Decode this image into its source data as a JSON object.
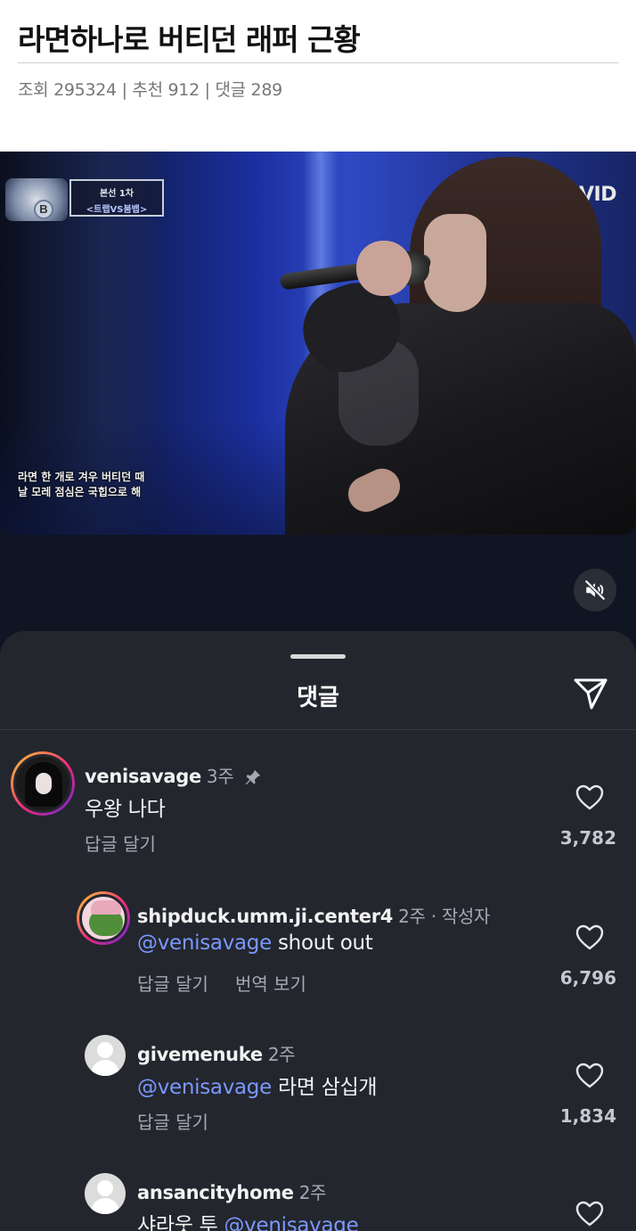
{
  "post": {
    "title": "라면하나로 버티던 래퍼 근황",
    "meta": "조회 295324 | 추천 912 | 댓글 289"
  },
  "video": {
    "round_line1": "본선 1차",
    "round_line2": "<트랩VS붐뱁>",
    "channel_logo": "VIVID",
    "subtitle_line1": "라면 한 개로 겨우 버티던 때",
    "subtitle_line2": "날 모레 점심은 국힙으로 해",
    "mute_icon": "speaker-muted-icon"
  },
  "comments_sheet": {
    "title": "댓글",
    "send_icon": "paper-plane-icon",
    "reply_label": "답글 달기",
    "translate_label": "번역 보기",
    "items": [
      {
        "username": "venisavage",
        "time": "3주",
        "pinned": true,
        "text": "우왕 나다",
        "likes": "3,782"
      },
      {
        "username": "shipduck.umm.ji.center4",
        "time": "2주 · 작성자",
        "mention": "@venisavage",
        "text": " shout out",
        "likes": "6,796"
      },
      {
        "username": "givemenuke",
        "time": "2주",
        "mention": "@venisavage",
        "text": " 라면 삼십개",
        "likes": "1,834"
      },
      {
        "username": "ansancityhome",
        "time": "2주",
        "prefix": "샤라웃 투 ",
        "mention": "@venisavage"
      }
    ]
  },
  "colors": {
    "sheet_bg": "#23262d",
    "mention": "#7b98ff",
    "muted_text": "#a3a8b3"
  }
}
